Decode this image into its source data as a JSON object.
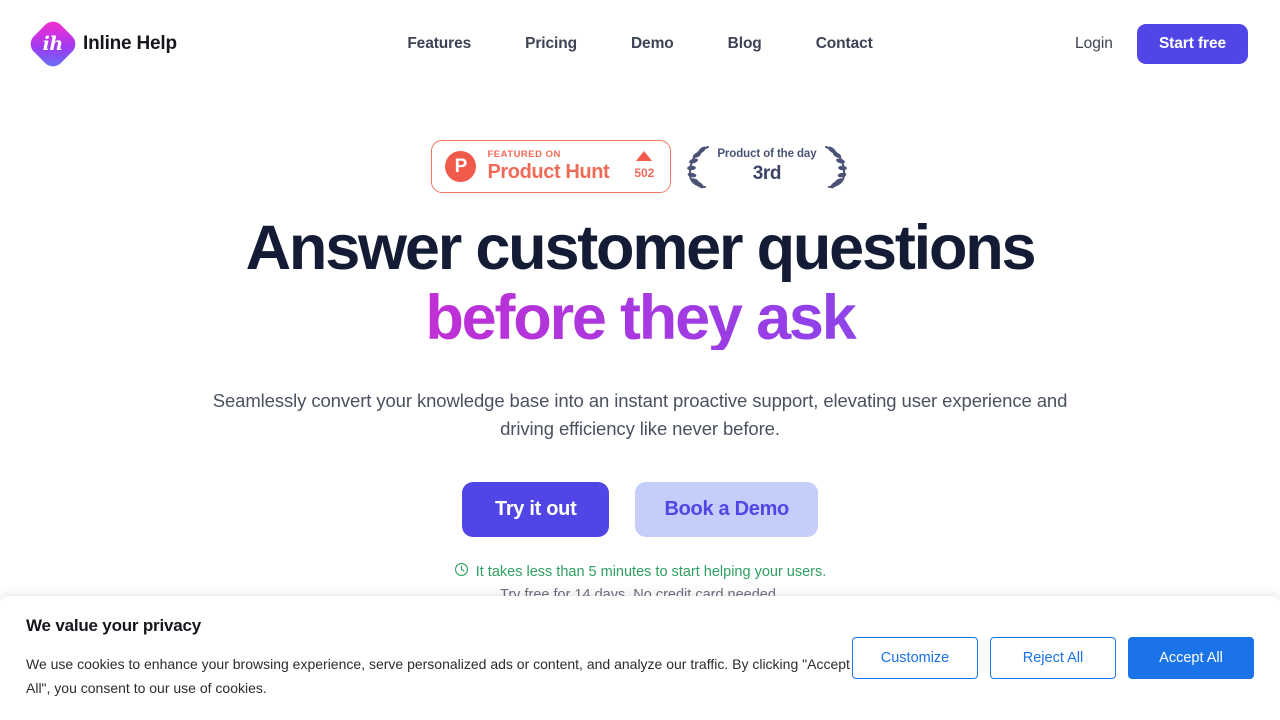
{
  "nav": {
    "brand_mark": "ih",
    "brand_name": "Inline Help",
    "links": [
      {
        "label": "Features"
      },
      {
        "label": "Pricing"
      },
      {
        "label": "Demo"
      },
      {
        "label": "Blog"
      },
      {
        "label": "Contact"
      }
    ],
    "login_label": "Login",
    "start_free_label": "Start free"
  },
  "badges": {
    "product_hunt": {
      "icon_letter": "P",
      "featured_label": "FEATURED ON",
      "name": "Product Hunt",
      "upvote_count": "502"
    },
    "laurel": {
      "title": "Product of the day",
      "rank": "3rd"
    }
  },
  "hero": {
    "headline_line1": "Answer customer questions",
    "headline_line2": "before they ask",
    "subtitle": "Seamlessly convert your knowledge base into an instant proactive support, elevating user experience and driving efficiency like never before.",
    "primary_cta": "Try it out",
    "secondary_cta": "Book a Demo",
    "note_green": "It takes less than 5 minutes to start helping your users.",
    "note_gray": "Try free for 14 days. No credit card needed."
  },
  "cookie": {
    "title": "We value your privacy",
    "body": "We use cookies to enhance your browsing experience, serve personalized ads or content, and analyze our traffic. By clicking \"Accept All\", you consent to our use of cookies.",
    "customize_label": "Customize",
    "reject_label": "Reject All",
    "accept_label": "Accept All"
  },
  "colors": {
    "brand_indigo": "#4f46e5",
    "gradient_start": "#ed22bb",
    "gradient_end": "#6168f2",
    "product_hunt": "#f06a58",
    "laurel_navy": "#4a5275",
    "note_green": "#2fa060",
    "cookie_blue": "#1a73e8",
    "headline_dark": "#141b34"
  }
}
